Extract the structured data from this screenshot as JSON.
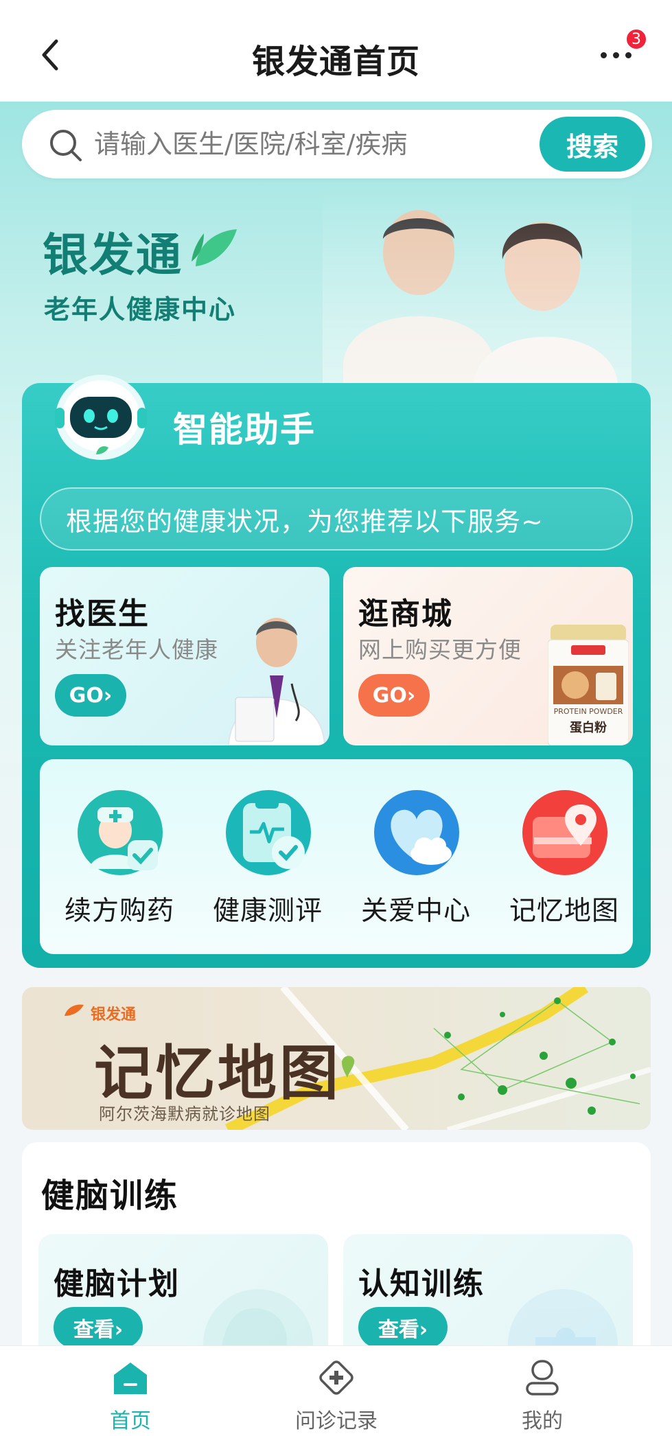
{
  "header": {
    "title": "银发通首页",
    "back_icon": "chevron-left-icon",
    "more_icon": "more-horizontal-icon",
    "notification_count": "3"
  },
  "search": {
    "placeholder": "请输入医生/医院/科室/疾病",
    "button_label": "搜索",
    "icon": "search-icon"
  },
  "brand": {
    "name": "银发通",
    "subtitle": "老年人健康中心",
    "accent_color": "#137e74"
  },
  "assistant": {
    "title": "智能助手",
    "message": "根据您的健康状况，为您推荐以下服务~",
    "cards": [
      {
        "title": "找医生",
        "subtitle": "关注老年人健康",
        "button": "GO›",
        "color": "#1bb3ad"
      },
      {
        "title": "逛商城",
        "subtitle": "网上购买更方便",
        "button": "GO›",
        "color": "#f5724a"
      }
    ],
    "product_label_en": "PROTEIN POWDER",
    "product_label_cn": "蛋白粉",
    "quick_items": [
      {
        "label": "续方购药",
        "icon": "nurse-prescription-icon"
      },
      {
        "label": "健康测评",
        "icon": "health-assessment-icon"
      },
      {
        "label": "关爱中心",
        "icon": "heart-cloud-icon"
      },
      {
        "label": "记忆地图",
        "icon": "map-pin-icon"
      }
    ]
  },
  "banner": {
    "brand": "银发通",
    "title": "记忆地图",
    "subtitle": "阿尔茨海默病就诊地图"
  },
  "brain_training": {
    "title": "健脑训练",
    "cards": [
      {
        "title": "健脑计划",
        "button": "查看›"
      },
      {
        "title": "认知训练",
        "button": "查看›"
      }
    ]
  },
  "bottom_nav": [
    {
      "label": "首页",
      "icon": "home-icon",
      "active": true
    },
    {
      "label": "问诊记录",
      "icon": "medical-record-icon",
      "active": false
    },
    {
      "label": "我的",
      "icon": "profile-icon",
      "active": false
    }
  ],
  "colors": {
    "primary": "#1bb3ad",
    "badge": "#f0233b",
    "mall_button": "#f5724a"
  }
}
